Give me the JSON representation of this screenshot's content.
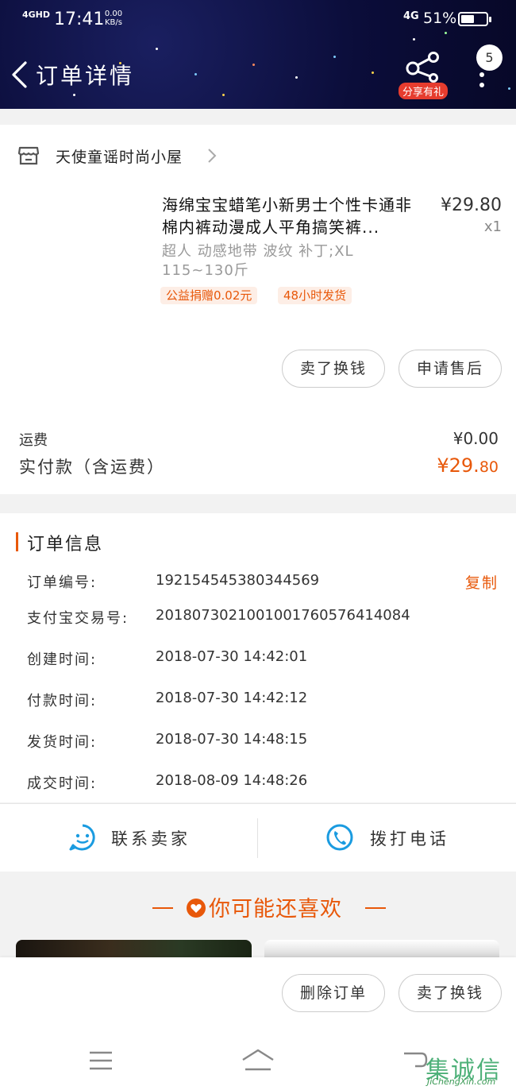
{
  "status_bar": {
    "signal": "4GHD",
    "time": "17:41",
    "speed_value": "0.00",
    "speed_unit": "KB/s",
    "network": "4G",
    "battery_pct": "51%"
  },
  "header": {
    "title": "订单详情",
    "share_badge": "分享有礼",
    "notification_count": "5"
  },
  "shop": {
    "name": "天使童谣时尚小屋"
  },
  "product": {
    "title": "海绵宝宝蜡笔小新男士个性卡通非棉内裤动漫成人平角搞笑裤...",
    "price": "¥29.80",
    "quantity": "x1",
    "spec": "超人 动感地带 波纹 补丁;XL 115~130斤",
    "tags": [
      "公益捐赠0.02元",
      "48小时发货"
    ]
  },
  "actions": {
    "resell": "卖了换钱",
    "after_sale": "申请售后"
  },
  "totals": {
    "shipping_label": "运费",
    "shipping_value": "¥0.00",
    "paid_label": "实付款（含运费）",
    "paid_main": "¥29.",
    "paid_cents": "80"
  },
  "order_info": {
    "heading": "订单信息",
    "copy_label": "复制",
    "rows": [
      {
        "label": "订单编号:",
        "value": "192154545380344569"
      },
      {
        "label": "支付宝交易号:",
        "value": "2018073021001001760576414084"
      },
      {
        "label": "创建时间:",
        "value": "2018-07-30 14:42:01"
      },
      {
        "label": "付款时间:",
        "value": "2018-07-30 14:42:12"
      },
      {
        "label": "发货时间:",
        "value": "2018-07-30 14:48:15"
      },
      {
        "label": "成交时间:",
        "value": "2018-08-09 14:48:26"
      }
    ]
  },
  "contact": {
    "chat_label": "联系卖家",
    "phone_label": "拨打电话"
  },
  "recommend": {
    "heading": "你可能还喜欢"
  },
  "bottom_actions": {
    "delete": "删除订单",
    "resell": "卖了换钱"
  },
  "watermark": {
    "glyphs": "集诚信",
    "text": "JiChengXin.com"
  },
  "colors": {
    "accent": "#e8580a",
    "header_bg": "#0b0d3a",
    "icon_blue": "#1a9be0"
  }
}
